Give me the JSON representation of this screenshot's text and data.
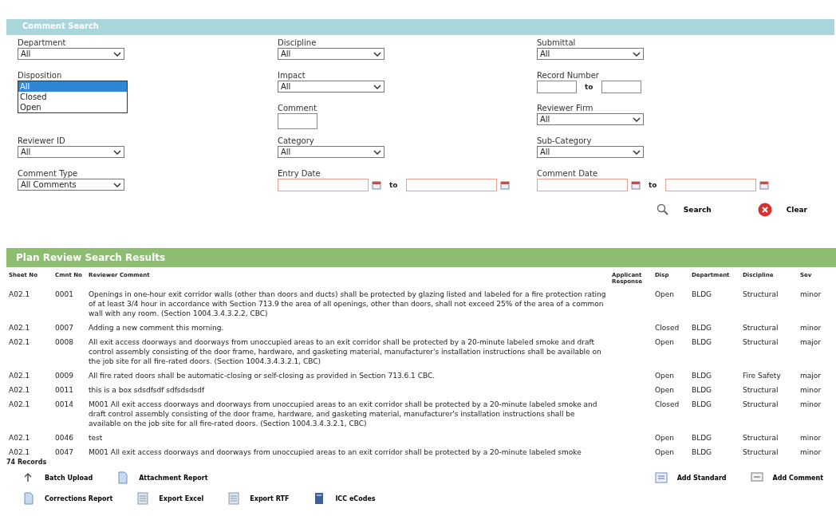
{
  "search_panel": {
    "title": "Comment Search",
    "filter_columns": [
      [
        {
          "label": "Department",
          "kind": "select",
          "value": "All"
        },
        {
          "label": "Disposition",
          "kind": "open_select",
          "options": [
            {
              "label": "All",
              "selected": true
            },
            {
              "label": "Closed",
              "selected": false
            },
            {
              "label": "Open",
              "selected": false
            }
          ]
        },
        {
          "label": "Reviewer ID",
          "kind": "select",
          "value": "All"
        },
        {
          "label": "Comment Type",
          "kind": "select",
          "value": "All Comments"
        }
      ],
      [
        {
          "label": "Discipline",
          "kind": "select",
          "value": "All"
        },
        {
          "label": "Impact",
          "kind": "select",
          "value": "All"
        },
        {
          "label": "Comment",
          "kind": "text"
        },
        {
          "label": "Category",
          "kind": "select",
          "value": "All"
        },
        {
          "label": "Entry Date",
          "kind": "date_range",
          "separator": "to"
        }
      ],
      [
        {
          "label": "Submittal",
          "kind": "select",
          "value": "All"
        },
        {
          "label": "Record Number",
          "kind": "range",
          "separator": "to"
        },
        {
          "label": "Reviewer Firm",
          "kind": "select",
          "value": "All"
        },
        {
          "label": "Sub-Category",
          "kind": "select",
          "value": "All"
        },
        {
          "label": "Comment Date",
          "kind": "date_range",
          "separator": "to"
        }
      ]
    ],
    "buttons": [
      {
        "label": "Search",
        "kind": "search"
      },
      {
        "label": "Clear",
        "kind": "clear"
      }
    ]
  },
  "results": {
    "title": "Plan Review Search Results",
    "columns": [
      "Sheet No",
      "Cmnt No",
      "Reviewer Comment",
      "Applicant Response",
      "Disp",
      "Department",
      "Discipline",
      "Sev"
    ],
    "rows": [
      [
        "A02.1",
        "0001",
        "Openings in one-hour exit corridor walls (other than doors and ducts) shall be protected by glazing listed and labeled for a fire protection rating of at least 3/4 hour in accordance with Section 713.9 the area of all openings, other than doors, shall not exceed 25% of the area of a common wall with any room. (Section 1004.3.4.3.2.2, CBC)",
        "",
        "Open",
        "BLDG",
        "Structural",
        "minor"
      ],
      [
        "A02.1",
        "0007",
        "Adding a new comment this morning.",
        "",
        "Closed",
        "BLDG",
        "Structural",
        "minor"
      ],
      [
        "A02.1",
        "0008",
        "All exit access doorways and doorways from unoccupied areas to an exit corridor shall be protected by a 20-minute labeled smoke and draft control assembly consisting of the door frame, hardware, and gasketing material, manufacturer's installation instructions shall be available on the job site for all fire-rated doors. (Section 1004.3.4.3.2.1, CBC)",
        "",
        "Open",
        "BLDG",
        "Structural",
        "major"
      ],
      [
        "A02.1",
        "0009",
        "All fire rated doors shall be automatic-closing or self-closing as provided in Section 713.6.1 CBC.",
        "",
        "Open",
        "BLDG",
        "Fire Safety",
        "major"
      ],
      [
        "A02.1",
        "0011",
        "this is a box sdsdfsdf sdfsdsdsdf",
        "",
        "Open",
        "BLDG",
        "Structural",
        "minor"
      ],
      [
        "A02.1",
        "0014",
        "M001 All exit access doorways and doorways from unoccupied areas to an exit corridor shall be protected by a 20-minute labeled smoke and draft control assembly consisting of the door frame, hardware, and gasketing material, manufacturer's installation instructions shall be available on the job site for all fire-rated doors. (Section 1004.3.4.3.2.1, CBC)",
        "",
        "Closed",
        "BLDG",
        "Structural",
        "minor"
      ],
      [
        "A02.1",
        "0046",
        "test",
        "",
        "Open",
        "BLDG",
        "Structural",
        "minor"
      ],
      [
        "A02.1",
        "0047",
        "M001 All exit access doorways and doorways from unoccupied areas to an exit corridor shall be protected by a 20-minute labeled smoke",
        "",
        "Open",
        "BLDG",
        "Structural",
        "minor"
      ]
    ],
    "record_count": "74 Records"
  },
  "action_rows": [
    {
      "left": [
        {
          "label": "Batch Upload",
          "kind": "upload"
        },
        {
          "label": "Attachment Report",
          "kind": "document"
        }
      ],
      "right": [
        {
          "label": "Add Standard",
          "kind": "list"
        },
        {
          "label": "Add Comment",
          "kind": "comment"
        }
      ]
    },
    {
      "left": [
        {
          "label": "Corrections Report",
          "kind": "document"
        },
        {
          "label": "Export Excel",
          "kind": "sheet"
        },
        {
          "label": "Export RTF",
          "kind": "sheet"
        },
        {
          "label": "ICC eCodes",
          "kind": "book"
        }
      ]
    }
  ]
}
